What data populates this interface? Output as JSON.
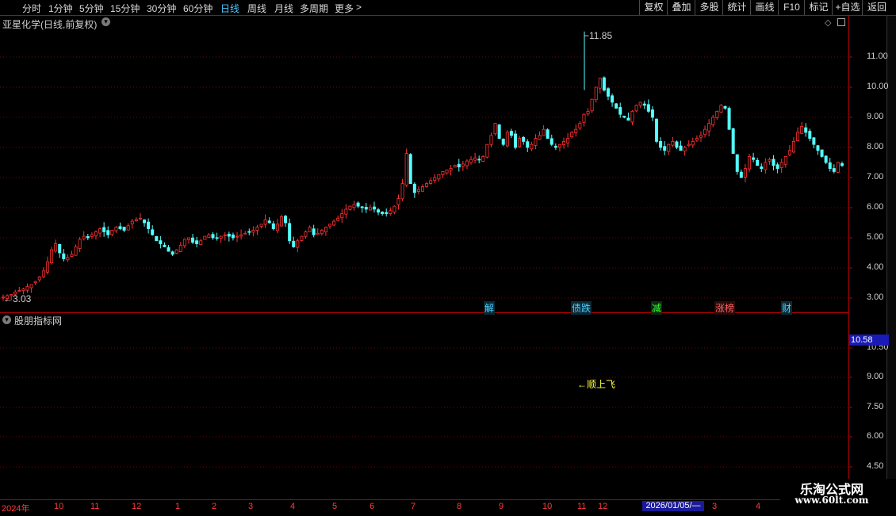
{
  "toolbar": {
    "periods": [
      "分时",
      "1分钟",
      "5分钟",
      "15分钟",
      "30分钟",
      "60分钟",
      "日线",
      "周线",
      "月线",
      "多周期",
      "更多"
    ],
    "active_period": "日线",
    "more_arrow": ">",
    "buttons": [
      "复权",
      "叠加",
      "多股",
      "统计",
      "画线",
      "F10",
      "标记",
      "+自选",
      "返回"
    ]
  },
  "main": {
    "title": "亚星化学(日线,前复权)",
    "high_label": "11.85",
    "low_label": "3.03",
    "y_ticks": [
      "11.00",
      "10.00",
      "9.00",
      "8.00",
      "7.00",
      "6.00",
      "5.00",
      "4.00",
      "3.00"
    ],
    "events": [
      {
        "label": "解",
        "color": "#4fd0ff"
      },
      {
        "label": "债跌",
        "color": "#4fd0ff"
      },
      {
        "label": "减",
        "color": "#3cff3c"
      },
      {
        "label": "涨榜",
        "color": "#ff6060"
      },
      {
        "label": "财",
        "color": "#4fd0ff"
      }
    ]
  },
  "indicator": {
    "title": "股朋指标网",
    "signal_text": "←顺上飞",
    "value_tag": "10.58",
    "y_ticks": [
      "10.50",
      "9.00",
      "7.50",
      "6.00",
      "4.50"
    ]
  },
  "date_axis": {
    "labels": [
      "2024年",
      "10",
      "11",
      "12",
      "1",
      "2",
      "3",
      "4",
      "5",
      "6",
      "7",
      "8",
      "9",
      "10",
      "11",
      "12",
      "3",
      "4"
    ],
    "cursor_date": "2026/01/05/—"
  },
  "watermark": {
    "title": "乐淘公式网",
    "url": "www.60lt.com"
  },
  "colors": {
    "up": "#ff3232",
    "down": "#54ffff",
    "grid": "#7a0000",
    "accent": "#4fc8ff"
  },
  "chart_data": {
    "type": "candlestick",
    "ylim": [
      2.7,
      12.5
    ],
    "closes": [
      3.03,
      3.08,
      3.12,
      3.2,
      3.25,
      3.3,
      3.38,
      3.45,
      3.55,
      3.7,
      3.9,
      4.2,
      4.6,
      4.8,
      4.5,
      4.3,
      4.35,
      4.45,
      4.7,
      4.95,
      5.05,
      5.0,
      5.1,
      5.2,
      5.3,
      5.2,
      5.1,
      5.25,
      5.35,
      5.3,
      5.25,
      5.4,
      5.55,
      5.6,
      5.65,
      5.5,
      5.3,
      5.1,
      4.9,
      4.8,
      4.7,
      4.55,
      4.45,
      4.6,
      4.75,
      4.95,
      5.0,
      4.85,
      4.8,
      4.9,
      5.05,
      5.1,
      5.0,
      5.0,
      5.05,
      5.1,
      5.05,
      5.0,
      5.05,
      5.1,
      5.15,
      5.2,
      5.25,
      5.35,
      5.45,
      5.6,
      5.5,
      5.3,
      5.45,
      5.7,
      5.5,
      4.9,
      4.7,
      4.9,
      5.05,
      5.2,
      5.35,
      5.1,
      5.15,
      5.25,
      5.35,
      5.45,
      5.55,
      5.65,
      5.8,
      5.95,
      6.05,
      6.1,
      6.05,
      6.0,
      5.95,
      6.0,
      5.95,
      5.85,
      5.8,
      5.8,
      5.9,
      6.05,
      6.3,
      6.8,
      7.8,
      6.8,
      6.5,
      6.6,
      6.7,
      6.8,
      6.9,
      7.0,
      7.1,
      7.2,
      7.25,
      7.3,
      7.4,
      7.35,
      7.45,
      7.55,
      7.6,
      7.65,
      7.6,
      7.7,
      8.1,
      8.4,
      8.8,
      8.3,
      8.1,
      8.5,
      8.4,
      8.0,
      8.3,
      8.2,
      8.0,
      8.1,
      8.3,
      8.4,
      8.6,
      8.3,
      8.1,
      8.0,
      8.1,
      8.2,
      8.3,
      8.5,
      8.6,
      8.8,
      9.1,
      9.2,
      9.6,
      10.0,
      10.3,
      9.9,
      9.7,
      9.5,
      9.3,
      9.1,
      9.0,
      8.9,
      9.2,
      9.4,
      9.5,
      9.4,
      9.2,
      9.0,
      8.2,
      8.0,
      7.9,
      8.1,
      8.2,
      8.0,
      7.9,
      8.0,
      8.1,
      8.2,
      8.3,
      8.4,
      8.6,
      8.8,
      9.0,
      9.2,
      9.4,
      9.3,
      8.6,
      7.8,
      7.2,
      7.0,
      7.3,
      7.7,
      7.6,
      7.4,
      7.3,
      7.5,
      7.6,
      7.4,
      7.3,
      7.5,
      7.7,
      7.9,
      8.2,
      8.5,
      8.7,
      8.5,
      8.3,
      8.1,
      7.9,
      7.7,
      7.5,
      7.3,
      7.2,
      7.5,
      7.4
    ]
  }
}
